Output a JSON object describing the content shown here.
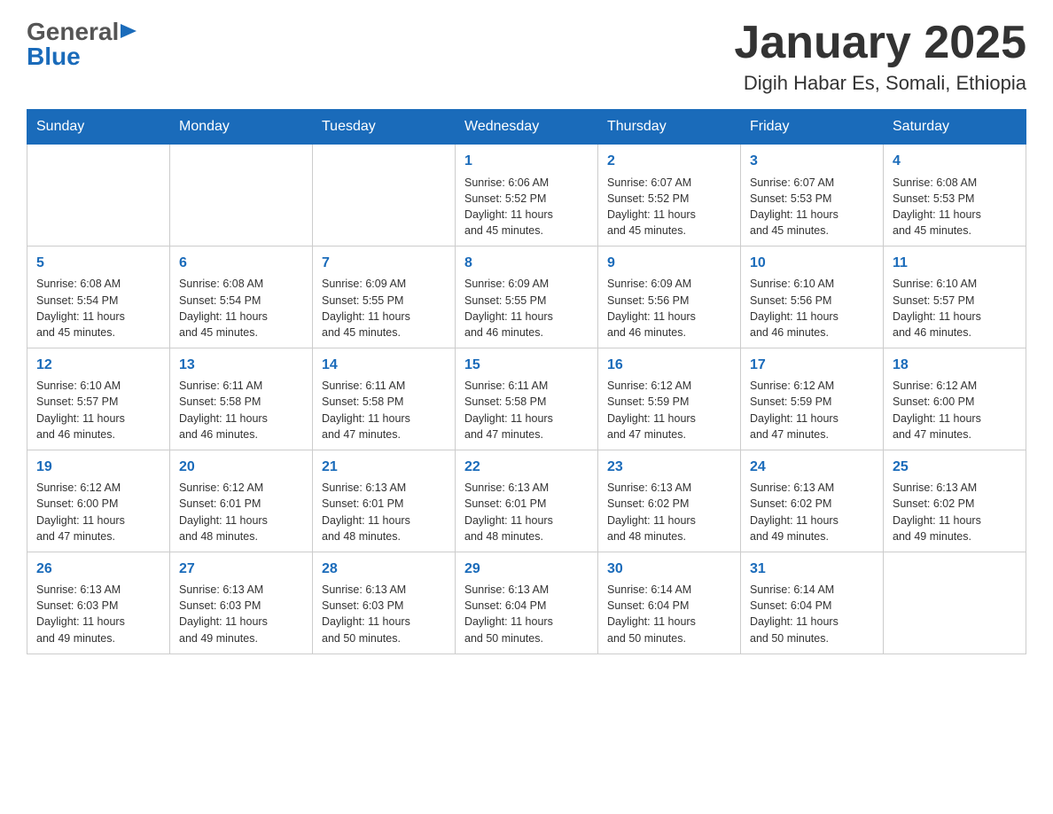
{
  "logo": {
    "general": "General",
    "blue": "Blue",
    "triangle": "▶"
  },
  "header": {
    "title": "January 2025",
    "subtitle": "Digih Habar Es, Somali, Ethiopia"
  },
  "weekdays": [
    "Sunday",
    "Monday",
    "Tuesday",
    "Wednesday",
    "Thursday",
    "Friday",
    "Saturday"
  ],
  "weeks": [
    [
      {
        "day": "",
        "info": ""
      },
      {
        "day": "",
        "info": ""
      },
      {
        "day": "",
        "info": ""
      },
      {
        "day": "1",
        "info": "Sunrise: 6:06 AM\nSunset: 5:52 PM\nDaylight: 11 hours\nand 45 minutes."
      },
      {
        "day": "2",
        "info": "Sunrise: 6:07 AM\nSunset: 5:52 PM\nDaylight: 11 hours\nand 45 minutes."
      },
      {
        "day": "3",
        "info": "Sunrise: 6:07 AM\nSunset: 5:53 PM\nDaylight: 11 hours\nand 45 minutes."
      },
      {
        "day": "4",
        "info": "Sunrise: 6:08 AM\nSunset: 5:53 PM\nDaylight: 11 hours\nand 45 minutes."
      }
    ],
    [
      {
        "day": "5",
        "info": "Sunrise: 6:08 AM\nSunset: 5:54 PM\nDaylight: 11 hours\nand 45 minutes."
      },
      {
        "day": "6",
        "info": "Sunrise: 6:08 AM\nSunset: 5:54 PM\nDaylight: 11 hours\nand 45 minutes."
      },
      {
        "day": "7",
        "info": "Sunrise: 6:09 AM\nSunset: 5:55 PM\nDaylight: 11 hours\nand 45 minutes."
      },
      {
        "day": "8",
        "info": "Sunrise: 6:09 AM\nSunset: 5:55 PM\nDaylight: 11 hours\nand 46 minutes."
      },
      {
        "day": "9",
        "info": "Sunrise: 6:09 AM\nSunset: 5:56 PM\nDaylight: 11 hours\nand 46 minutes."
      },
      {
        "day": "10",
        "info": "Sunrise: 6:10 AM\nSunset: 5:56 PM\nDaylight: 11 hours\nand 46 minutes."
      },
      {
        "day": "11",
        "info": "Sunrise: 6:10 AM\nSunset: 5:57 PM\nDaylight: 11 hours\nand 46 minutes."
      }
    ],
    [
      {
        "day": "12",
        "info": "Sunrise: 6:10 AM\nSunset: 5:57 PM\nDaylight: 11 hours\nand 46 minutes."
      },
      {
        "day": "13",
        "info": "Sunrise: 6:11 AM\nSunset: 5:58 PM\nDaylight: 11 hours\nand 46 minutes."
      },
      {
        "day": "14",
        "info": "Sunrise: 6:11 AM\nSunset: 5:58 PM\nDaylight: 11 hours\nand 47 minutes."
      },
      {
        "day": "15",
        "info": "Sunrise: 6:11 AM\nSunset: 5:58 PM\nDaylight: 11 hours\nand 47 minutes."
      },
      {
        "day": "16",
        "info": "Sunrise: 6:12 AM\nSunset: 5:59 PM\nDaylight: 11 hours\nand 47 minutes."
      },
      {
        "day": "17",
        "info": "Sunrise: 6:12 AM\nSunset: 5:59 PM\nDaylight: 11 hours\nand 47 minutes."
      },
      {
        "day": "18",
        "info": "Sunrise: 6:12 AM\nSunset: 6:00 PM\nDaylight: 11 hours\nand 47 minutes."
      }
    ],
    [
      {
        "day": "19",
        "info": "Sunrise: 6:12 AM\nSunset: 6:00 PM\nDaylight: 11 hours\nand 47 minutes."
      },
      {
        "day": "20",
        "info": "Sunrise: 6:12 AM\nSunset: 6:01 PM\nDaylight: 11 hours\nand 48 minutes."
      },
      {
        "day": "21",
        "info": "Sunrise: 6:13 AM\nSunset: 6:01 PM\nDaylight: 11 hours\nand 48 minutes."
      },
      {
        "day": "22",
        "info": "Sunrise: 6:13 AM\nSunset: 6:01 PM\nDaylight: 11 hours\nand 48 minutes."
      },
      {
        "day": "23",
        "info": "Sunrise: 6:13 AM\nSunset: 6:02 PM\nDaylight: 11 hours\nand 48 minutes."
      },
      {
        "day": "24",
        "info": "Sunrise: 6:13 AM\nSunset: 6:02 PM\nDaylight: 11 hours\nand 49 minutes."
      },
      {
        "day": "25",
        "info": "Sunrise: 6:13 AM\nSunset: 6:02 PM\nDaylight: 11 hours\nand 49 minutes."
      }
    ],
    [
      {
        "day": "26",
        "info": "Sunrise: 6:13 AM\nSunset: 6:03 PM\nDaylight: 11 hours\nand 49 minutes."
      },
      {
        "day": "27",
        "info": "Sunrise: 6:13 AM\nSunset: 6:03 PM\nDaylight: 11 hours\nand 49 minutes."
      },
      {
        "day": "28",
        "info": "Sunrise: 6:13 AM\nSunset: 6:03 PM\nDaylight: 11 hours\nand 50 minutes."
      },
      {
        "day": "29",
        "info": "Sunrise: 6:13 AM\nSunset: 6:04 PM\nDaylight: 11 hours\nand 50 minutes."
      },
      {
        "day": "30",
        "info": "Sunrise: 6:14 AM\nSunset: 6:04 PM\nDaylight: 11 hours\nand 50 minutes."
      },
      {
        "day": "31",
        "info": "Sunrise: 6:14 AM\nSunset: 6:04 PM\nDaylight: 11 hours\nand 50 minutes."
      },
      {
        "day": "",
        "info": ""
      }
    ]
  ]
}
